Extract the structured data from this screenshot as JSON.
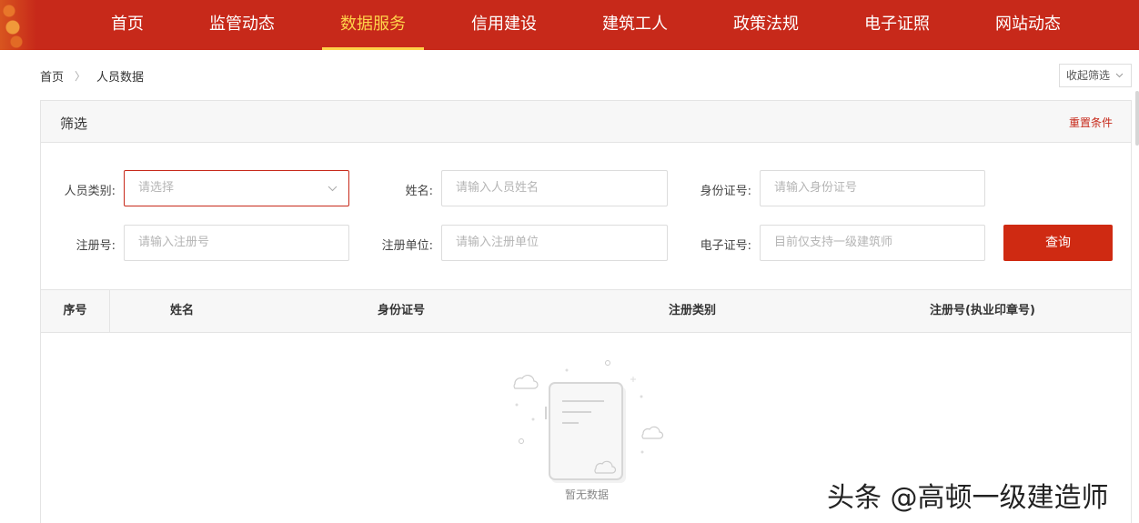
{
  "nav": {
    "items": [
      "首页",
      "监管动态",
      "数据服务",
      "信用建设",
      "建筑工人",
      "政策法规",
      "电子证照",
      "网站动态"
    ],
    "active_index": 2
  },
  "breadcrumb": {
    "home": "首页",
    "separator": "〉",
    "current": "人员数据"
  },
  "collapse_button": {
    "label": "收起筛选",
    "icon": "chevron-down-icon"
  },
  "filter": {
    "title": "筛选",
    "reset_label": "重置条件",
    "person_type": {
      "label": "人员类别:",
      "placeholder": "请选择"
    },
    "name": {
      "label": "姓名:",
      "placeholder": "请输入人员姓名"
    },
    "id_number": {
      "label": "身份证号:",
      "placeholder": "请输入身份证号"
    },
    "reg_number": {
      "label": "注册号:",
      "placeholder": "请输入注册号"
    },
    "reg_company": {
      "label": "注册单位:",
      "placeholder": "请输入注册单位"
    },
    "e_cert": {
      "label": "电子证号:",
      "placeholder": "目前仅支持一级建筑师"
    },
    "query_label": "查询"
  },
  "table": {
    "columns": [
      "序号",
      "姓名",
      "身份证号",
      "注册类别",
      "注册号(执业印章号)"
    ],
    "rows": [],
    "empty_text": "暂无数据"
  },
  "watermark": "头条 @高顿一级建造师",
  "colors": {
    "brand_red": "#c7291a",
    "nav_active": "#ffd24a",
    "query_button": "#cf2a12"
  }
}
